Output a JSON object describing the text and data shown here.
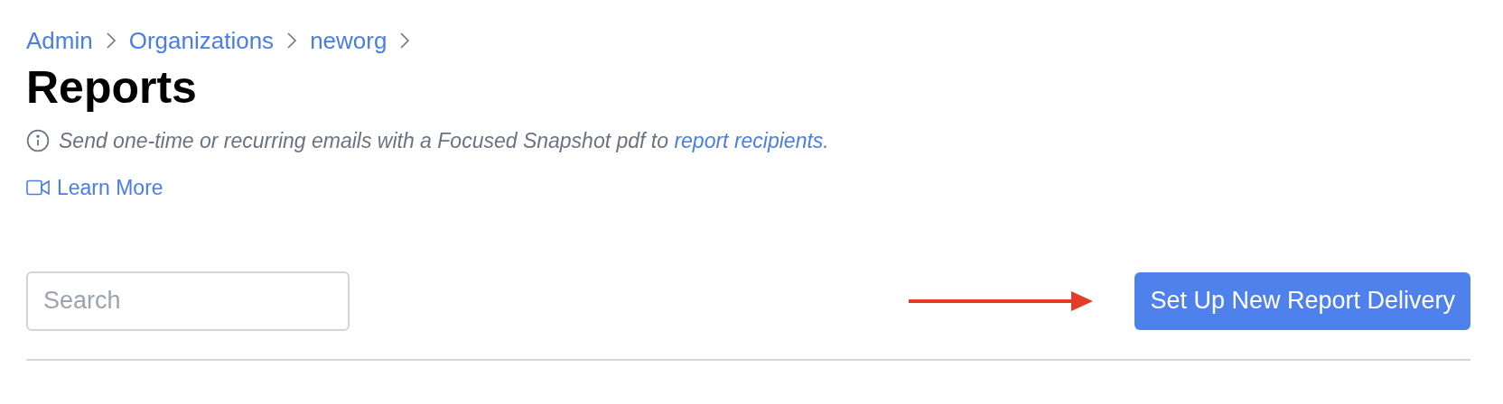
{
  "breadcrumb": [
    "Admin",
    "Organizations",
    "neworg"
  ],
  "title": "Reports",
  "info": {
    "text": "Send one-time or recurring emails with a Focused Snapshot pdf to ",
    "link": "report recipients",
    "end": "."
  },
  "learn_more": "Learn More",
  "search": {
    "placeholder": "Search"
  },
  "primary_button": "Set Up New Report Delivery"
}
